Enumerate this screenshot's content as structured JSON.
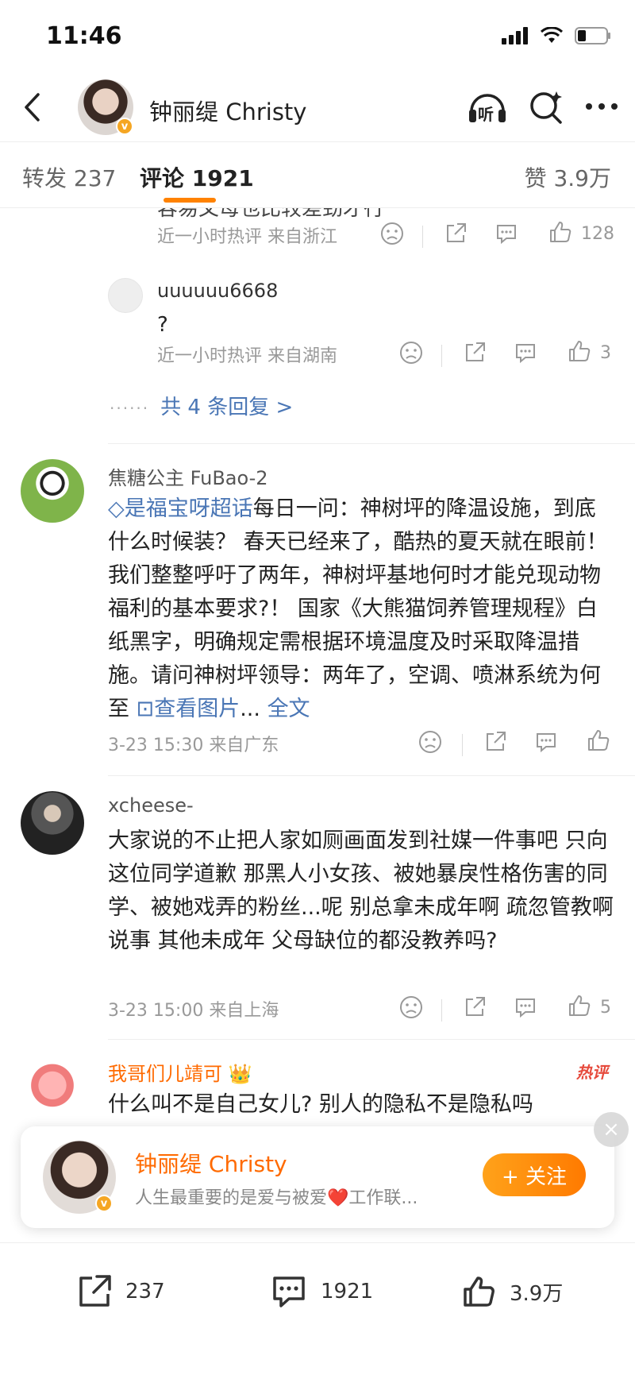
{
  "status_bar": {
    "time": "11:46"
  },
  "nav": {
    "title": "钟丽缇 Christy",
    "badge": "v",
    "listen_label": "听"
  },
  "tabs": {
    "repost": "转发 237",
    "comment": "评论 1921",
    "like": "赞 3.9万"
  },
  "comment0": {
    "cut_text": "容易父母也比较差劲才行",
    "meta": "近一小时热评  来自浙江",
    "likes": "128",
    "reply": {
      "name": "uuuuuu6668",
      "text": "?",
      "meta": "近一小时热评  来自湖南",
      "likes": "3"
    },
    "more_replies": "共 4 条回复 >",
    "more_dots": "······"
  },
  "comment1": {
    "name": "焦糖公主 FuBao-2",
    "topic": "是福宝呀超话",
    "topic_icon": "diamond-icon",
    "body": "每日一问：神树坪的降温设施，到底什么时候装？ 春天已经来了，酷热的夏天就在眼前！我们整整呼吁了两年，神树坪基地何时才能兑现动物福利的基本要求?！ 国家《大熊猫饲养管理规程》白纸黑字，明确规定需根据环境温度及时采取降温措施。请问神树坪领导：两年了，空调、喷淋系统为何至 ",
    "view_image": "查看图片",
    "ellipsis": "... ",
    "full_text": "全文",
    "meta": "3-23 15:30  来自广东"
  },
  "comment2": {
    "name": "xcheese-",
    "body": "大家说的不止把人家如厕画面发到社媒一件事吧 只向这位同学道歉 那黑人小女孩、被她暴戾性格伤害的同学、被她戏弄的粉丝...呢 别总拿未成年啊 疏忽管教啊说事 其他未成年 父母缺位的都没教养吗?",
    "meta": "3-23 15:00  来自上海",
    "likes": "5"
  },
  "comment3": {
    "name": "我哥们儿靖可",
    "crown": "👑",
    "hot_tag": "热评",
    "body": "什么叫不是自己女儿? 别人的隐私不是隐私吗"
  },
  "follow_card": {
    "name": "钟丽缇 Christy",
    "bio_before": "人生最重要的是爱与被爱",
    "heart": "❤️",
    "bio_after": "工作联...",
    "follow_label": "+ 关注",
    "close": "×"
  },
  "bottom_bar": {
    "repost_count": "237",
    "comment_count": "1921",
    "like_count": "3.9万"
  },
  "colors": {
    "accent": "#ff8200",
    "link": "#4a76b5",
    "hot": "#e64a3c"
  }
}
